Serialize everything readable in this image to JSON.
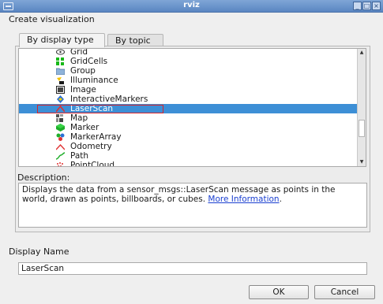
{
  "window": {
    "title": "rviz"
  },
  "dialog": {
    "heading": "Create visualization",
    "tabs": [
      {
        "label": "By display type",
        "active": true
      },
      {
        "label": "By topic",
        "active": false
      }
    ],
    "display_types": [
      {
        "label": "Grid",
        "icon": "grid-icon"
      },
      {
        "label": "GridCells",
        "icon": "gridcells-icon"
      },
      {
        "label": "Group",
        "icon": "folder-icon"
      },
      {
        "label": "Illuminance",
        "icon": "illuminance-icon"
      },
      {
        "label": "Image",
        "icon": "image-icon"
      },
      {
        "label": "InteractiveMarkers",
        "icon": "interactive-markers-icon"
      },
      {
        "label": "LaserScan",
        "icon": "laserscan-icon",
        "selected": true
      },
      {
        "label": "Map",
        "icon": "map-icon"
      },
      {
        "label": "Marker",
        "icon": "marker-icon"
      },
      {
        "label": "MarkerArray",
        "icon": "marker-array-icon"
      },
      {
        "label": "Odometry",
        "icon": "odometry-icon"
      },
      {
        "label": "Path",
        "icon": "path-icon"
      },
      {
        "label": "PointCloud",
        "icon": "pointcloud-icon"
      }
    ],
    "description_label": "Description:",
    "description_text": "Displays the data from a sensor_msgs::LaserScan message as points in the world, drawn as points, billboards, or cubes.",
    "description_link": "More Information",
    "description_suffix": ".",
    "display_name_label": "Display Name",
    "display_name_value": "LaserScan",
    "ok_label": "OK",
    "cancel_label": "Cancel"
  },
  "colors": {
    "selection": "#3d8fd6",
    "highlight_outline": "#d8232a",
    "titlebar": "#6a93cb",
    "link": "#1a3fd0"
  }
}
